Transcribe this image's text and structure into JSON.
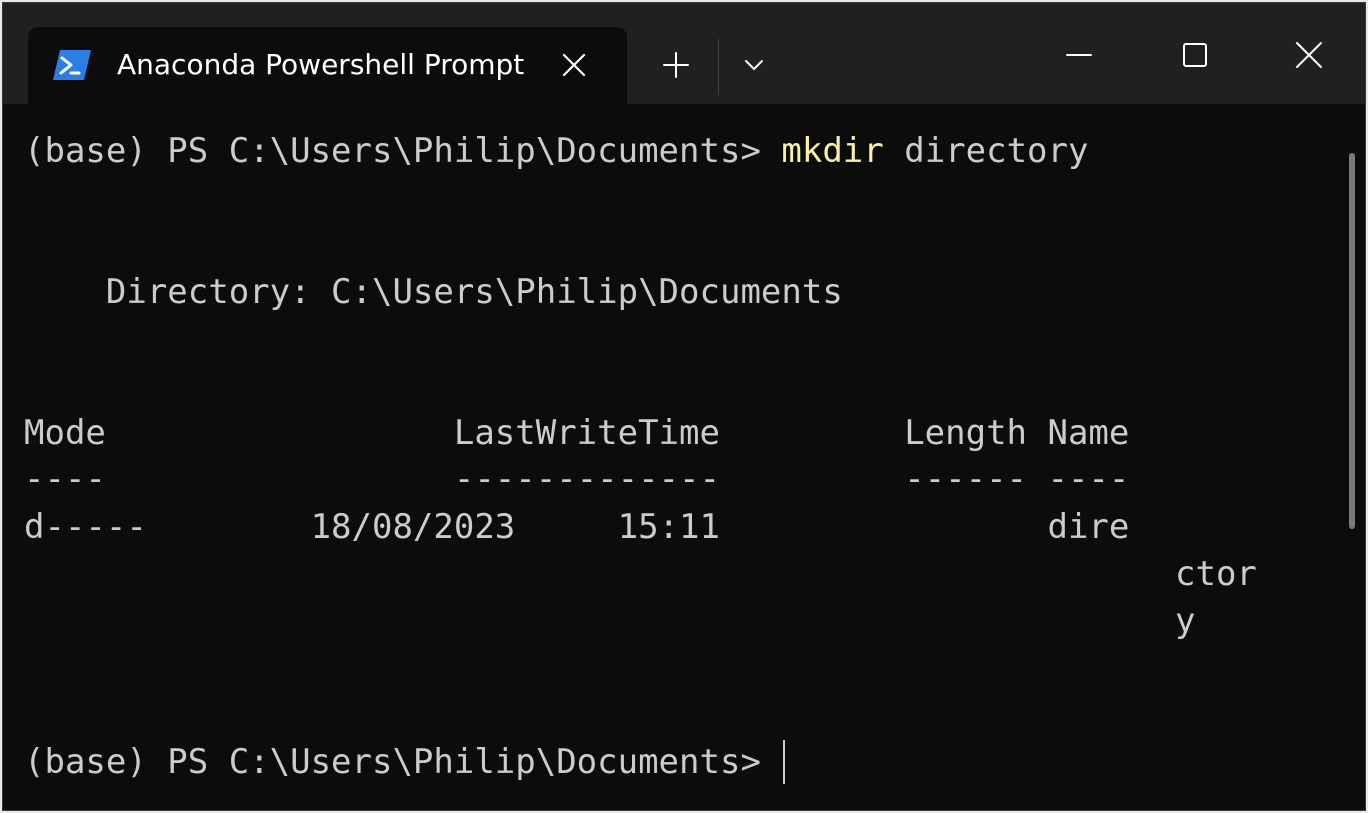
{
  "window": {
    "tab_title": "Anaconda Powershell Prompt",
    "accent": "#f9f1a5"
  },
  "icons": {
    "tab": "powershell-icon",
    "close": "close-icon",
    "new_tab": "plus-icon",
    "dropdown": "chevron-down-icon",
    "minimize": "minimize-icon",
    "maximize": "maximize-icon",
    "window_close": "close-icon"
  },
  "terminal": {
    "prompt1": "(base) PS C:\\Users\\Philip\\Documents> ",
    "command": "mkdir",
    "command_arg": " directory",
    "directory_line": "    Directory: C:\\Users\\Philip\\Documents",
    "headers": "Mode                 LastWriteTime         Length Name",
    "separators": "----                 -------------         ------ ----",
    "row": {
      "line1": "d-----        18/08/2023     15:11                dire",
      "line2": "ctor",
      "line3": "y"
    },
    "prompt2": "(base) PS C:\\Users\\Philip\\Documents> "
  }
}
